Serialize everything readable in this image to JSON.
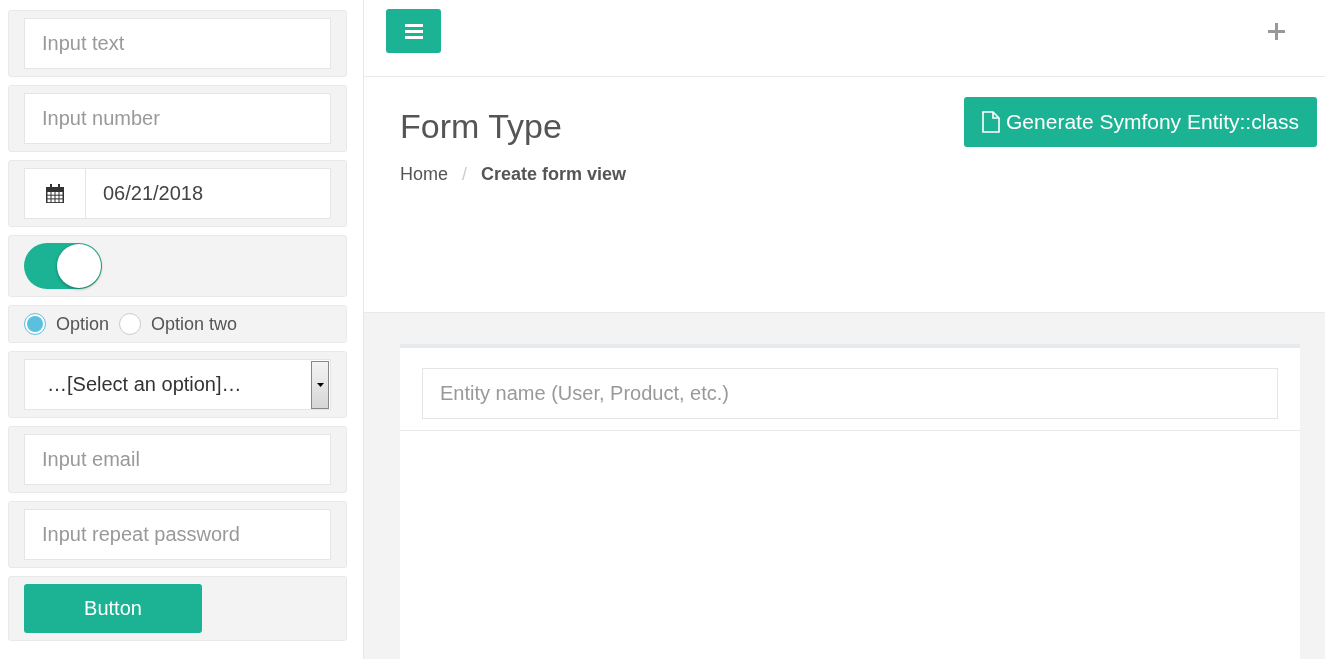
{
  "sidebar": {
    "items": [
      {
        "kind": "text",
        "placeholder": "Input text"
      },
      {
        "kind": "text",
        "placeholder": "Input number"
      },
      {
        "kind": "date",
        "value": "06/21/2018"
      },
      {
        "kind": "toggle",
        "on": true
      },
      {
        "kind": "radios",
        "options": [
          {
            "label": "Option",
            "selected": true
          },
          {
            "label": "Option two",
            "selected": false
          }
        ]
      },
      {
        "kind": "select",
        "value": "…[Select an option]…"
      },
      {
        "kind": "text",
        "placeholder": "Input email"
      },
      {
        "kind": "text",
        "placeholder": "Input repeat password"
      },
      {
        "kind": "button",
        "label": "Button"
      }
    ]
  },
  "header": {
    "title": "Form Type",
    "separator": "/",
    "breadcrumb": [
      {
        "label": "Home",
        "selected": false
      },
      {
        "label": "Create form view",
        "selected": true
      }
    ],
    "action": "Generate Symfony Entity::class"
  },
  "form": {
    "placeholder": "Entity name (User, Product, etc.)"
  }
}
